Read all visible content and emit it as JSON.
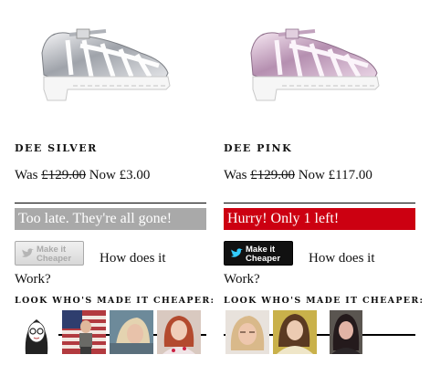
{
  "products": [
    {
      "name": "DEE SILVER",
      "was_label": "Was",
      "old_price": "£129.00",
      "now_label": "Now",
      "now_price": "£3.00",
      "status": "Too late. They're all gone!",
      "status_color": "#a9a9a9",
      "shoe_color": "silver",
      "button_label_line1": "Make it",
      "button_label_line2": "Cheaper",
      "button_state": "disabled",
      "how_label": "How does it Work?",
      "look_label": "LOOK WHO'S MADE IT CHEAPER:",
      "avatars": [
        "sketch-girl",
        "flag-boy",
        "blonde-girl",
        "red-hair-girl"
      ]
    },
    {
      "name": "DEE PINK",
      "was_label": "Was",
      "old_price": "£129.00",
      "now_label": "Now",
      "now_price": "£117.00",
      "status": "Hurry! Only 1 left!",
      "status_color": "#cc0011",
      "shoe_color": "pink",
      "button_label_line1": "Make it",
      "button_label_line2": "Cheaper",
      "button_state": "active",
      "how_label": "How does it Work?",
      "look_label": "LOOK WHO'S MADE IT CHEAPER:",
      "avatars": [
        "blonde-girl-2",
        "brunette-girl",
        "dark-hair-girl"
      ]
    }
  ]
}
